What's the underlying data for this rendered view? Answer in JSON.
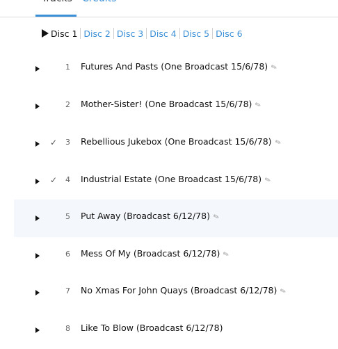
{
  "tabs": {
    "tracks": "Tracks",
    "credits": "Credits"
  },
  "discs": [
    "Disc 1",
    "Disc 2",
    "Disc 3",
    "Disc 4",
    "Disc 5",
    "Disc 6"
  ],
  "tracks": [
    {
      "num": "1",
      "checked": "",
      "title": "Futures And Pasts (One Broadcast 15/6/78)"
    },
    {
      "num": "2",
      "checked": "",
      "title": "Mother-Sister! (One Broadcast 15/6/78)"
    },
    {
      "num": "3",
      "checked": "✓",
      "title": "Rebellious Jukebox (One Broadcast 15/6/78)"
    },
    {
      "num": "4",
      "checked": "✓",
      "title": "Industrial Estate (One Broadcast 15/6/78)"
    },
    {
      "num": "5",
      "checked": "",
      "title": "Put Away (Broadcast 6/12/78)"
    },
    {
      "num": "6",
      "checked": "",
      "title": "Mess Of My (Broadcast 6/12/78)"
    },
    {
      "num": "7",
      "checked": "",
      "title": "No Xmas For John Quays (Broadcast 6/12/78)"
    },
    {
      "num": "8",
      "checked": "",
      "title": "Like To Blow (Broadcast 6/12/78)"
    }
  ],
  "icons": {
    "play": "play-icon",
    "edit": "pencil-icon",
    "check": "check-icon"
  },
  "colors": {
    "link": "#3b8fd6",
    "highlight_row": "#f4f7fb"
  }
}
